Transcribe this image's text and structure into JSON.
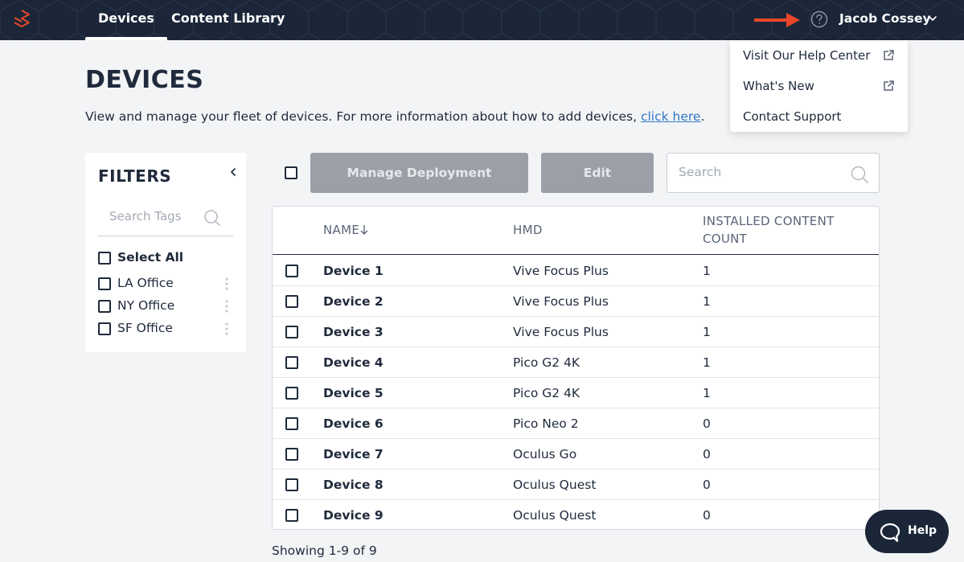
{
  "topbar": {
    "tabs": [
      {
        "label": "Devices",
        "active": true
      },
      {
        "label": "Content Library",
        "active": false
      }
    ],
    "user_name": "Jacob Cossey",
    "icons": {
      "logo": "brand-logo-icon",
      "help": "question-circle-icon",
      "menu": "chevron-down-icon",
      "pointer": "red-arrow-icon"
    },
    "arrow_color": "#e8472b"
  },
  "help_menu": {
    "items": [
      {
        "label": "Visit Our Help Center",
        "icon": "external-link-icon"
      },
      {
        "label": "What's New",
        "icon": "external-link-icon"
      },
      {
        "label": "Contact Support"
      }
    ]
  },
  "page": {
    "title": "DEVICES",
    "subtitle_text": "View and manage your fleet of devices. For more information about how to add devices, ",
    "subtitle_link": "click here",
    "subtitle_end": "."
  },
  "filters": {
    "title": "FILTERS",
    "search_placeholder": "Search Tags",
    "select_all": "Select All",
    "tags": [
      {
        "label": "LA Office"
      },
      {
        "label": "NY Office"
      },
      {
        "label": "SF Office"
      }
    ]
  },
  "toolbar": {
    "manage_label": "Manage Deployment",
    "edit_label": "Edit",
    "search_placeholder": "Search"
  },
  "table": {
    "columns": {
      "name": "NAME",
      "hmd": "HMD",
      "count_line1": "INSTALLED CONTENT",
      "count_line2": "COUNT"
    },
    "rows": [
      {
        "name": "Device 1",
        "hmd": "Vive Focus Plus",
        "count": "1"
      },
      {
        "name": "Device 2",
        "hmd": "Vive Focus Plus",
        "count": "1"
      },
      {
        "name": "Device 3",
        "hmd": "Vive Focus Plus",
        "count": "1"
      },
      {
        "name": "Device 4",
        "hmd": "Pico G2 4K",
        "count": "1"
      },
      {
        "name": "Device 5",
        "hmd": "Pico G2 4K",
        "count": "1"
      },
      {
        "name": "Device 6",
        "hmd": "Pico Neo 2",
        "count": "0"
      },
      {
        "name": "Device 7",
        "hmd": "Oculus Go",
        "count": "0"
      },
      {
        "name": "Device 8",
        "hmd": "Oculus Quest",
        "count": "0"
      },
      {
        "name": "Device 9",
        "hmd": "Oculus Quest",
        "count": "0"
      }
    ]
  },
  "footer": {
    "showing": "Showing 1-9 of 9"
  },
  "help_widget": {
    "label": "Help"
  }
}
